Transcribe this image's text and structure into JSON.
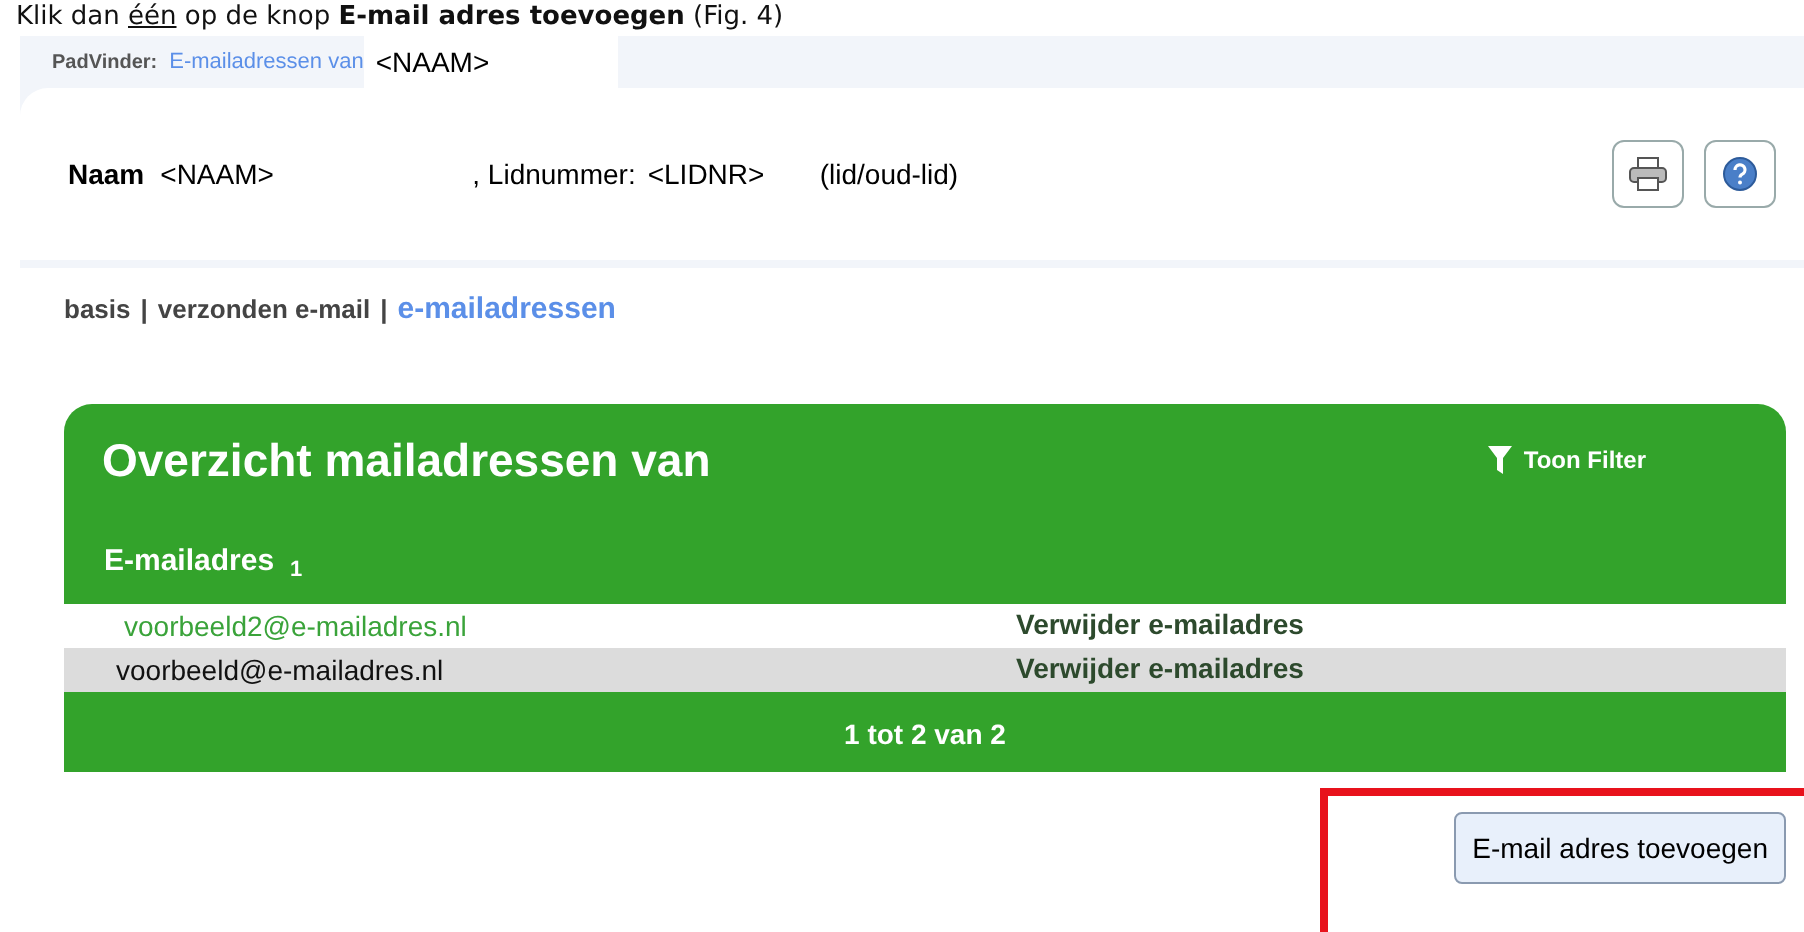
{
  "caption": {
    "parts": [
      {
        "text": "Klik dan ",
        "kind": "plain"
      },
      {
        "text": "één",
        "kind": "underline"
      },
      {
        "text": " op de knop ",
        "kind": "plain"
      },
      {
        "text": "E-mail adres toevoegen",
        "kind": "bold"
      },
      {
        "text": " (Fig. 4)",
        "kind": "plain"
      }
    ]
  },
  "breadcrumb": {
    "label": "PadVinder:",
    "link": "E-mailadressen van",
    "name": "<NAAM>"
  },
  "member": {
    "name_label": "Naam",
    "name": "<NAAM>",
    "number_label": ", Lidnummer:",
    "number": "<LIDNR>",
    "status": "(lid/oud-lid)"
  },
  "tabs": [
    {
      "label": "basis",
      "selected": false,
      "separator": "|"
    },
    {
      "label": "verzonden e-mail",
      "selected": false,
      "separator": "|"
    },
    {
      "label": "e-mailadressen",
      "selected": true
    }
  ],
  "panel": {
    "title": "Overzicht mailadressen van",
    "filter": "Toon Filter",
    "column": "E-mailadres",
    "sort": "1",
    "rows": [
      {
        "email": "voorbeeld2@e-mailadres.nl",
        "action": "Verwijder e-mailadres",
        "hovered": true
      },
      {
        "email": "voorbeeld@e-mailadres.nl",
        "action": "Verwijder e-mailadres",
        "hovered": false
      }
    ],
    "pager": "1 tot 2 van 2"
  },
  "add_button": "E-mail adres toevoegen"
}
